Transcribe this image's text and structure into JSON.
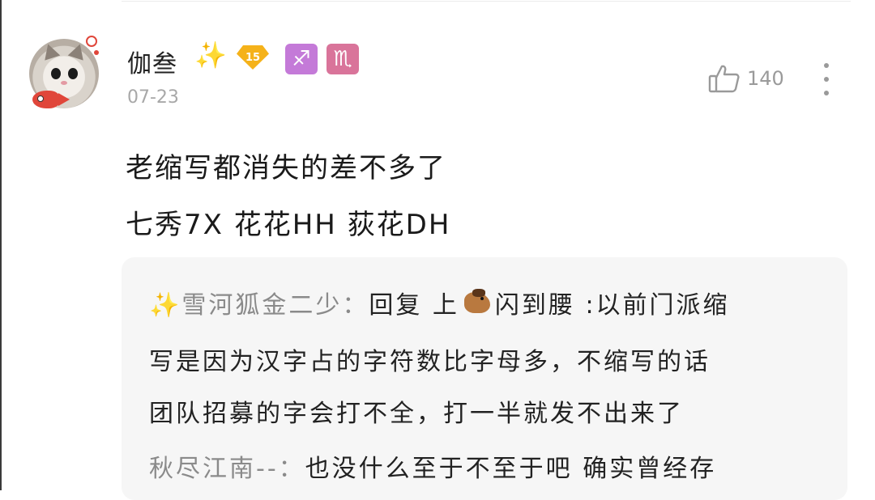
{
  "post": {
    "username": "伽叁",
    "sparkle_glyph": "✨",
    "level": "15",
    "zodiac_1": "♐",
    "zodiac_2": "♏",
    "date": "07-23",
    "like_count": "140",
    "content_line_1": "老缩写都消失的差不多了",
    "content_line_2": "七秀7X 花花HH 荻花DH",
    "icons": {
      "like": "thumbs-up-icon",
      "more": "more-vertical-icon",
      "avatar": "cat-avatar"
    },
    "colors": {
      "level_badge": "#f5b21a",
      "sagittarius": "#c47ad8",
      "scorpio": "#d9749a",
      "frame_accent": "#e0463a"
    }
  },
  "replies": [
    {
      "author": "雪河狐金二少：",
      "text_part1": "回复 上",
      "text_part2": "闪到腰 :以前门派缩",
      "line2": "写是因为汉字占的字符数比字母多，不缩写的话",
      "line3": "团队招募的字会打不全，打一半就发不出来了"
    },
    {
      "author": "秋尽江南--：",
      "text": "也没什么至于不至于吧 确实曾经存"
    }
  ]
}
